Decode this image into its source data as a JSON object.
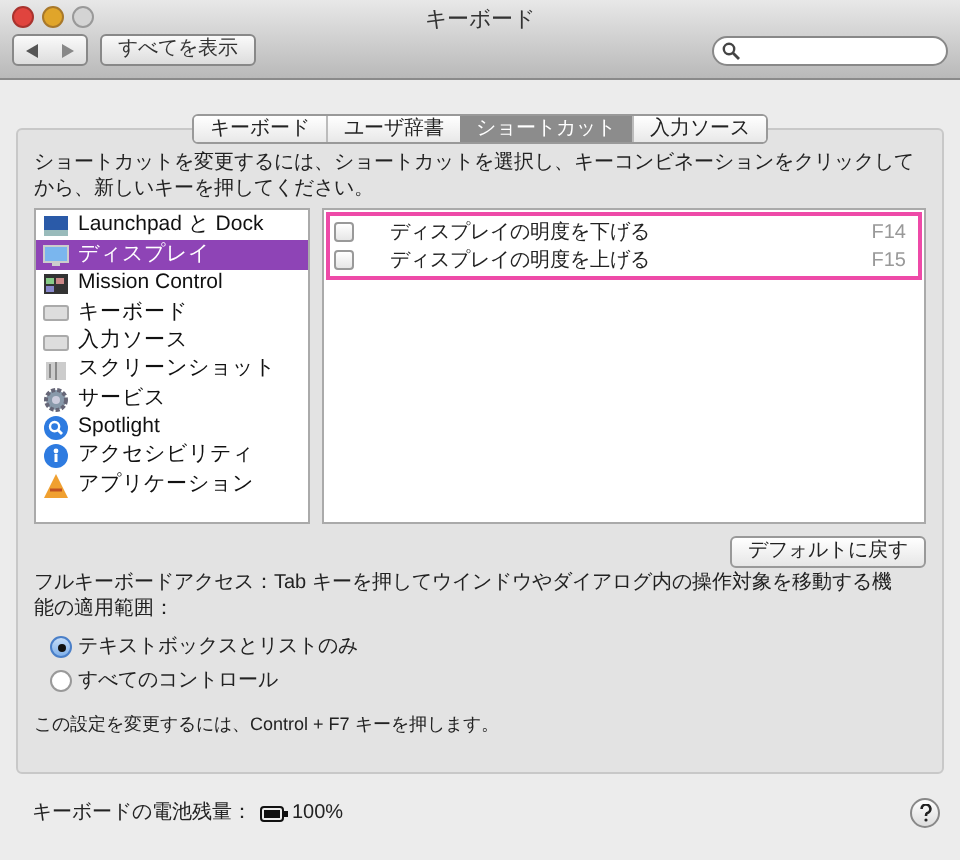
{
  "window": {
    "title": "キーボード"
  },
  "toolbar": {
    "show_all": "すべてを表示"
  },
  "tabs": [
    {
      "label": "キーボード",
      "selected": false
    },
    {
      "label": "ユーザ辞書",
      "selected": false
    },
    {
      "label": "ショートカット",
      "selected": true
    },
    {
      "label": "入力ソース",
      "selected": false
    }
  ],
  "instructions": "ショートカットを変更するには、ショートカットを選択し、キーコンビネーションをクリックしてから、新しいキーを押してください。",
  "categories": [
    {
      "label": "Launchpad と Dock",
      "selected": false
    },
    {
      "label": "ディスプレイ",
      "selected": true
    },
    {
      "label": "Mission Control",
      "selected": false
    },
    {
      "label": "キーボード",
      "selected": false
    },
    {
      "label": "入力ソース",
      "selected": false
    },
    {
      "label": "スクリーンショット",
      "selected": false
    },
    {
      "label": "サービス",
      "selected": false
    },
    {
      "label": "Spotlight",
      "selected": false
    },
    {
      "label": "アクセシビリティ",
      "selected": false
    },
    {
      "label": "アプリケーション",
      "selected": false
    }
  ],
  "shortcuts": [
    {
      "label": "ディスプレイの明度を下げる",
      "key": "F14",
      "checked": false
    },
    {
      "label": "ディスプレイの明度を上げる",
      "key": "F15",
      "checked": false
    }
  ],
  "restore_button": "デフォルトに戻す",
  "full_keyboard_access": "フルキーボードアクセス：Tab キーを押してウインドウやダイアログ内の操作対象を移動する機能の適用範囲：",
  "access_options": [
    {
      "label": "テキストボックスとリストのみ",
      "selected": true
    },
    {
      "label": "すべてのコントロール",
      "selected": false
    }
  ],
  "note": "この設定を変更するには、Control + F7 キーを押します。",
  "battery": {
    "label": "キーボードの電池残量：",
    "value": "100%"
  }
}
